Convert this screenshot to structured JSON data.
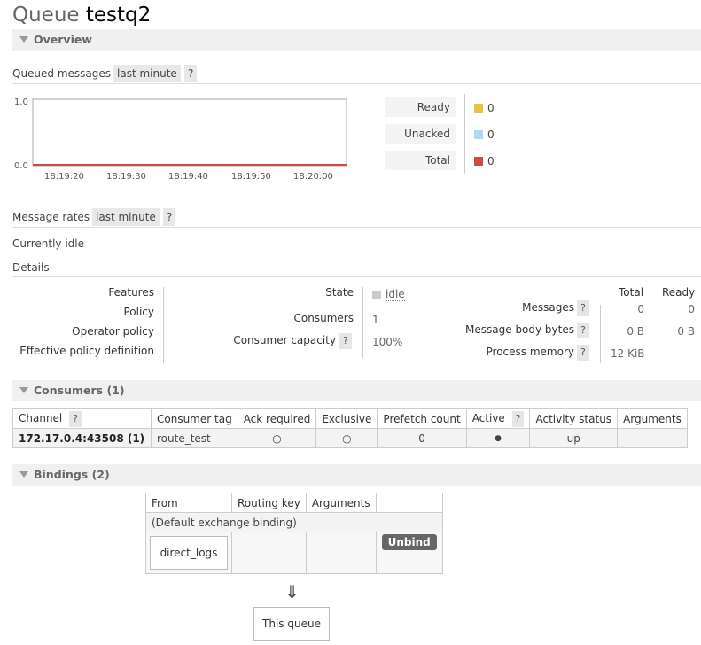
{
  "page": {
    "title_prefix": "Queue",
    "queue_name": "testq2"
  },
  "sections": {
    "overview": "Overview",
    "consumers": "Consumers (1)",
    "bindings": "Bindings (2)"
  },
  "queued_messages": {
    "label": "Queued messages",
    "range": "last minute",
    "help": "?",
    "chart": {
      "y_ticks": [
        "1.0",
        "0.0"
      ],
      "x_ticks": [
        "18:19:20",
        "18:19:30",
        "18:19:40",
        "18:19:50",
        "18:20:00"
      ]
    },
    "legend": [
      {
        "label": "Ready",
        "value": "0",
        "color": "#edc240"
      },
      {
        "label": "Unacked",
        "value": "0",
        "color": "#afd8f8"
      },
      {
        "label": "Total",
        "value": "0",
        "color": "#cb4b4b"
      }
    ]
  },
  "message_rates": {
    "label": "Message rates",
    "range": "last minute",
    "help": "?"
  },
  "idle_text": "Currently idle",
  "details": {
    "label": "Details",
    "left_labels": [
      "Features",
      "Policy",
      "Operator policy",
      "Effective policy definition"
    ],
    "state_label": "State",
    "state_value": "idle",
    "consumers_label": "Consumers",
    "consumers_value": "1",
    "capacity_label": "Consumer capacity",
    "capacity_value": "100%",
    "help": "?",
    "col_total": "Total",
    "col_ready": "Ready",
    "messages_label": "Messages",
    "messages_total": "0",
    "messages_ready": "0",
    "body_bytes_label": "Message body bytes",
    "body_bytes_total": "0 B",
    "body_bytes_ready": "0 B",
    "process_memory_label": "Process memory",
    "process_memory_value": "12 KiB"
  },
  "consumers_table": {
    "headers": [
      "Channel",
      "Consumer tag",
      "Ack required",
      "Exclusive",
      "Prefetch count",
      "Active",
      "Activity status",
      "Arguments"
    ],
    "help": "?",
    "row": {
      "channel": "172.17.0.4:43508 (1)",
      "consumer_tag": "route_test",
      "ack_required": "○",
      "exclusive": "○",
      "prefetch": "0",
      "active": "●",
      "status": "up",
      "arguments": ""
    }
  },
  "bindings_table": {
    "headers": [
      "From",
      "Routing key",
      "Arguments"
    ],
    "default_row": "(Default exchange binding)",
    "from": "direct_logs",
    "unbind": "Unbind"
  },
  "arrow": "⇓",
  "this_queue": "This queue"
}
